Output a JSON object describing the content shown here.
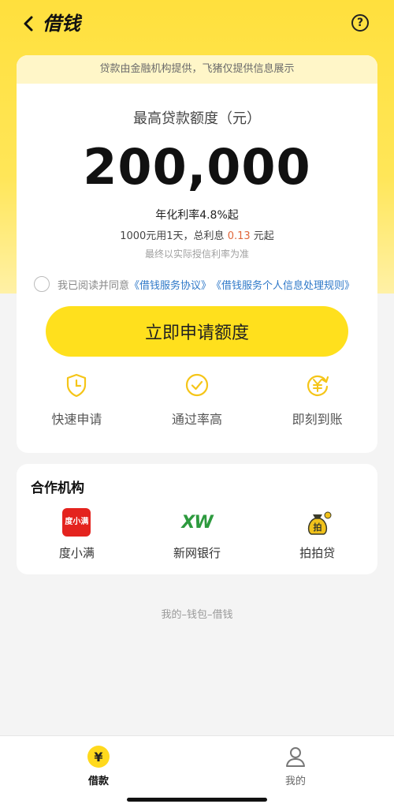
{
  "header": {
    "title": "借钱"
  },
  "notice": "贷款由金融机构提供，飞猪仅提供信息展示",
  "loan": {
    "amount_label": "最高贷款额度（元）",
    "amount": "200,000",
    "rate": "年化利率4.8%起",
    "interest_prefix": "1000元用1天，总利息",
    "interest_value": "0.13",
    "interest_suffix": "元起",
    "final_note": "最终以实际授信利率为准"
  },
  "agreement": {
    "prefix": "我已阅读并同意",
    "link1": "《借钱服务协议》",
    "link2": "《借钱服务个人信息处理规则》"
  },
  "apply_button": "立即申请额度",
  "features": [
    {
      "label": "快速申请",
      "icon": "shield-clock-icon"
    },
    {
      "label": "通过率高",
      "icon": "check-circle-icon"
    },
    {
      "label": "即刻到账",
      "icon": "yuan-refresh-icon"
    }
  ],
  "partners": {
    "title": "合作机构",
    "items": [
      {
        "label": "度小满",
        "logo_text": "度小满"
      },
      {
        "label": "新网银行",
        "logo_text": "XW"
      },
      {
        "label": "拍拍贷",
        "logo_text": "拍"
      }
    ]
  },
  "footer_path": "我的–钱包–借钱",
  "tabs": [
    {
      "label": "借款",
      "icon_text": "¥"
    },
    {
      "label": "我的"
    }
  ],
  "colors": {
    "brand_yellow": "#ffe01d",
    "accent_orange": "#e0673b",
    "link_blue": "#2e78c8",
    "icon_yellow": "#f5c518"
  }
}
